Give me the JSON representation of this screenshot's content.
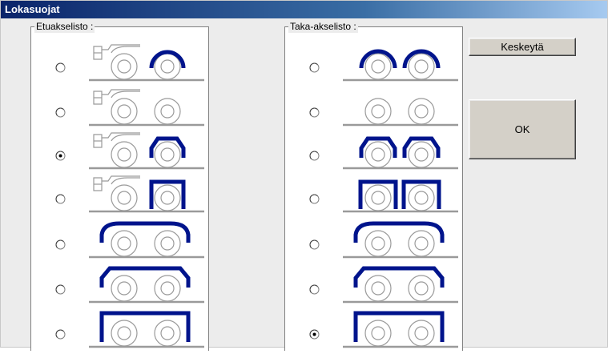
{
  "window": {
    "title": "Lokasuojat"
  },
  "front_group": {
    "label": "Etuakselisto :",
    "selected_index": 2,
    "options": [
      "cab-rear-round-fender",
      "cab-no-fender",
      "cab-rear-angled-fender",
      "cab-rear-square-fender",
      "tandem-round-fender",
      "tandem-angled-fender",
      "tandem-square-fender"
    ]
  },
  "rear_group": {
    "label": "Taka-akselisto :",
    "selected_index": 6,
    "options": [
      "separate-round-fenders",
      "no-fenders",
      "separate-angled-fenders",
      "separate-square-fenders",
      "single-round-fender",
      "single-angled-fender",
      "single-square-fender"
    ]
  },
  "buttons": {
    "cancel": "Keskeytä",
    "ok": "OK"
  },
  "colors": {
    "fender": "#00148c",
    "wheel": "#9a9a9a",
    "title_bar": "#0a246a"
  }
}
